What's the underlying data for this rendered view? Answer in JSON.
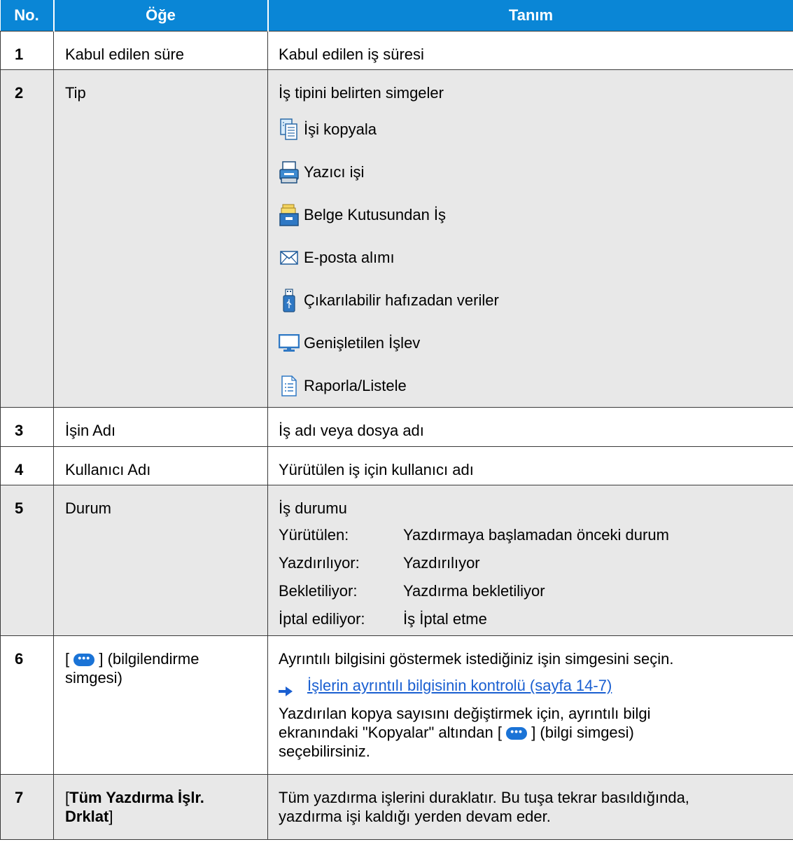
{
  "header": {
    "no": "No.",
    "item": "Öğe",
    "desc": "Tanım"
  },
  "rows": [
    {
      "no": "1",
      "item": "Kabul edilen süre",
      "desc": "Kabul edilen iş süresi"
    },
    {
      "no": "2",
      "item": "Tip",
      "desc": "İş tipini belirten simgeler",
      "types": [
        {
          "icon": "copy-job-icon",
          "label": "İşi kopyala"
        },
        {
          "icon": "printer-job-icon",
          "label": "Yazıcı işi"
        },
        {
          "icon": "document-box-icon",
          "label": "Belge Kutusundan İş"
        },
        {
          "icon": "envelope-icon",
          "label": "E-posta alımı"
        },
        {
          "icon": "usb-memory-icon",
          "label": "Çıkarılabilir hafızadan veriler"
        },
        {
          "icon": "monitor-icon",
          "label": "Genişletilen İşlev"
        },
        {
          "icon": "report-list-icon",
          "label": "Raporla/Listele"
        }
      ]
    },
    {
      "no": "3",
      "item": "İşin Adı",
      "desc": "İş adı veya dosya adı"
    },
    {
      "no": "4",
      "item": "Kullanıcı Adı",
      "desc": "Yürütülen iş için kullanıcı adı"
    },
    {
      "no": "5",
      "item": "Durum",
      "desc": "İş durumu",
      "statuses": [
        {
          "key": "Yürütülen:",
          "value": "Yazdırmaya başlamadan önceki durum"
        },
        {
          "key": "Yazdırılıyor:",
          "value": "Yazdırılıyor"
        },
        {
          "key": "Bekletiliyor:",
          "value": "Yazdırma bekletiliyor"
        },
        {
          "key": "İptal ediliyor:",
          "value": "İş İptal etme"
        }
      ]
    },
    {
      "no": "6",
      "item_prefix": "[",
      "item_suffix": "] (bilgilendirme",
      "item_line2": "simgesi)",
      "desc": "Ayrıntılı bilgisini göstermek istediğiniz işin simgesini seçin.",
      "link": "İşlerin ayrıntılı bilgisinin kontrolü (sayfa 14-7)",
      "note_line1": "Yazdırılan kopya sayısını değiştirmek için, ayrıntılı bilgi",
      "note_line2_prefix": "ekranındaki \"Kopyalar\" altından [",
      "note_line2_suffix": "] (bilgi simgesi)",
      "note_line3": "seçebilirsiniz.",
      "info_glyph": "•••"
    },
    {
      "no": "7",
      "item_open": "[",
      "item_bold1": "Tüm Yazdırma İşlr.",
      "item_bold2": "Drklat",
      "item_close": "]",
      "desc_line1": "Tüm yazdırma işlerini duraklatır. Bu tuşa tekrar basıldığında,",
      "desc_line2": "yazdırma işi kaldığı yerden devam eder."
    }
  ],
  "colors": {
    "header_bg": "#0a86d6",
    "shaded_row": "#e8e8e8",
    "link": "#1a5fd1",
    "info_button": "#1a73d6"
  }
}
